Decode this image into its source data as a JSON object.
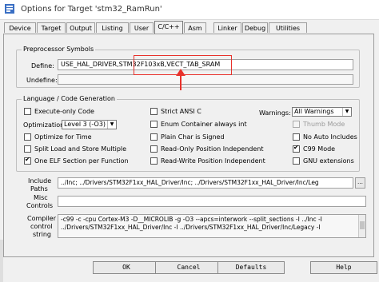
{
  "window": {
    "title": "Options for Target 'stm32_RamRun'",
    "accent": "#e8322c"
  },
  "tabs": [
    {
      "label": "Device"
    },
    {
      "label": "Target"
    },
    {
      "label": "Output"
    },
    {
      "label": "Listing"
    },
    {
      "label": "User"
    },
    {
      "label": "C/C++"
    },
    {
      "label": "Asm"
    },
    {
      "label": "Linker"
    },
    {
      "label": "Debug"
    },
    {
      "label": "Utilities"
    }
  ],
  "preprocessor": {
    "legend": "Preprocessor Symbols",
    "define_label": "Define:",
    "define_value": "USE_HAL_DRIVER,STM32F103xB,VECT_TAB_SRAM",
    "undefine_label": "Undefine:",
    "undefine_value": ""
  },
  "codegen": {
    "legend": "Language / Code Generation",
    "execute_only": "Execute-only Code",
    "optimization_label": "Optimization:",
    "optimization_value": "Level 3 (-O3)",
    "optimize_time": "Optimize for Time",
    "split_load": "Split Load and Store Multiple",
    "one_elf": "One ELF Section per Function",
    "strict_ansi": "Strict ANSI C",
    "enum_container": "Enum Container always int",
    "plain_char": "Plain Char is Signed",
    "ro_pi": "Read-Only Position Independent",
    "rw_pi": "Read-Write Position Independent",
    "warnings_label": "Warnings:",
    "warnings_value": "All Warnings",
    "thumb_mode": "Thumb Mode",
    "no_auto_includes": "No Auto Includes",
    "c99_mode": "C99 Mode",
    "gnu_extensions": "GNU extensions"
  },
  "paths": {
    "include_label_1": "Include",
    "include_label_2": "Paths",
    "include_value": "../Inc;    ../Drivers/STM32F1xx_HAL_Driver/Inc;    ../Drivers/STM32F1xx_HAL_Driver/Inc/Leg",
    "misc_label_1": "Misc",
    "misc_label_2": "Controls",
    "misc_value": "",
    "compiler_label_1": "Compiler",
    "compiler_label_2": "control",
    "compiler_label_3": "string",
    "compiler_line_1": "-c99 -c -cpu Cortex-M3 -D__MICROLIB -g -O3 --apcs=interwork --split_sections -I ../Inc -I",
    "compiler_line_2": "../Drivers/STM32F1xx_HAL_Driver/Inc -I ../Drivers/STM32F1xx_HAL_Driver/Inc/Legacy -I"
  },
  "buttons": {
    "ok": "OK",
    "cancel": "Cancel",
    "defaults": "Defaults",
    "help": "Help"
  }
}
